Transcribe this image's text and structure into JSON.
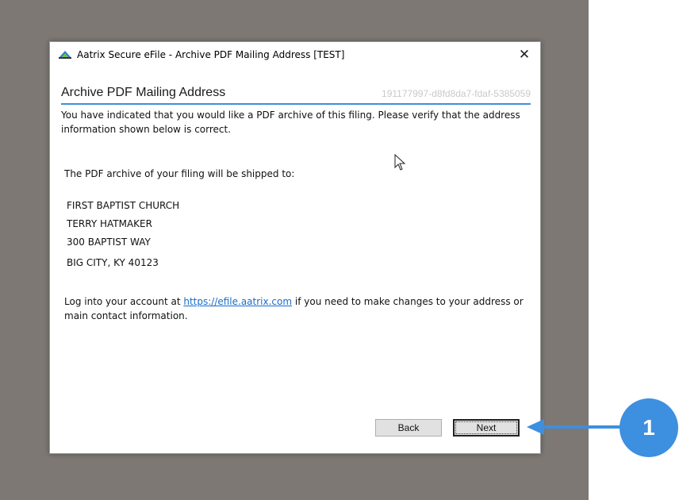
{
  "window": {
    "title": "Aatrix Secure eFile - Archive PDF Mailing Address [TEST]",
    "close_label": "✕",
    "app_icon": "aatrix-logo-icon"
  },
  "page": {
    "heading": "Archive PDF Mailing Address",
    "filing_id": "191177997-d8fd8da7-fdaf-5385059",
    "intro": "You have indicated that you would like a PDF archive of this filing. Please verify that the address information shown below is correct.",
    "shipped_label": "The PDF archive of your filing will be shipped to:",
    "address": {
      "line1": "FIRST BAPTIST CHURCH",
      "line2": "TERRY HATMAKER",
      "line3": "300 BAPTIST WAY",
      "line4": "BIG CITY, KY 40123"
    },
    "login_prefix": "Log into your account at ",
    "login_link": "https://efile.aatrix.com",
    "login_suffix": " if you need to make changes to your address or main contact information."
  },
  "buttons": {
    "back": "Back",
    "next": "Next"
  },
  "callout": {
    "number": "1",
    "color": "#3d8fe0"
  },
  "colors": {
    "backdrop": "#7d7874",
    "accent": "#3d8fd8",
    "link": "#1a6cc9"
  }
}
